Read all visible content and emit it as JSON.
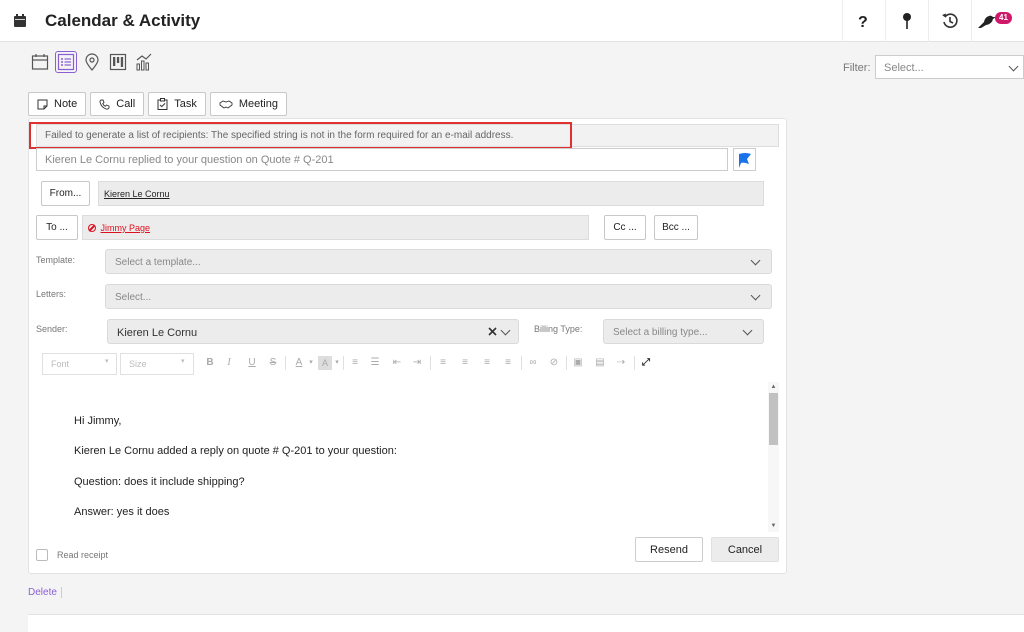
{
  "header": {
    "title": "Calendar & Activity",
    "icons": [
      "calendar-icon",
      "help-icon",
      "pin-icon",
      "history-icon",
      "bird-icon"
    ],
    "notification_count": "41"
  },
  "views": [
    "calendar-view-icon",
    "list-view-icon",
    "map-view-icon",
    "board-view-icon",
    "chart-view-icon"
  ],
  "filter": {
    "label": "Filter:",
    "placeholder": "Select..."
  },
  "activity_tabs": [
    {
      "label": "Note",
      "icon": "note-icon"
    },
    {
      "label": "Call",
      "icon": "phone-icon"
    },
    {
      "label": "Task",
      "icon": "clipboard-icon"
    },
    {
      "label": "Meeting",
      "icon": "handshake-icon"
    }
  ],
  "form": {
    "error_message": "Failed to generate a list of recipients: The specified string is not in the form required for an e-mail address.",
    "subject": "Kieren Le Cornu replied to your question on Quote # Q-201",
    "from_button": "From...",
    "from_value": "Kieren Le Cornu",
    "to_button": "To ...",
    "to_value": "Jimmy Page",
    "cc_button": "Cc ...",
    "bcc_button": "Bcc ...",
    "template_label": "Template:",
    "template_placeholder": "Select a template...",
    "letters_label": "Letters:",
    "letters_placeholder": "Select...",
    "sender_label": "Sender:",
    "sender_value": "Kieren Le Cornu",
    "billing_label": "Billing Type:",
    "billing_placeholder": "Select a billing type...",
    "font_placeholder": "Font",
    "size_placeholder": "Size",
    "body_lines": [
      "Hi Jimmy,",
      "Kieren Le Cornu added a reply on quote # Q-201 to your question:",
      "Question: does it include shipping?",
      "Answer: yes it does"
    ],
    "read_receipt": "Read receipt",
    "resend": "Resend",
    "cancel": "Cancel"
  },
  "footer": {
    "delete": "Delete"
  },
  "colors": {
    "accent": "#8b5fd4",
    "error": "#e03030",
    "flag": "#1a73e8",
    "badge": "#d0186a"
  }
}
